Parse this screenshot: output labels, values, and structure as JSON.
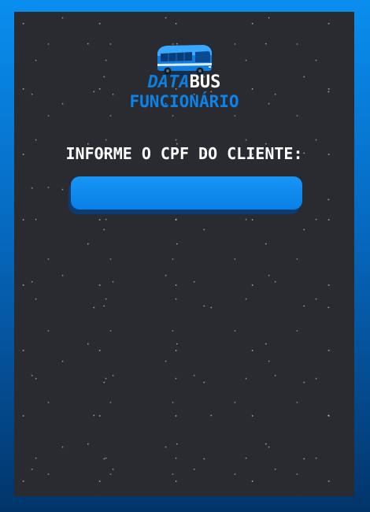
{
  "brand": {
    "part1": "DATA",
    "part2": "BUS",
    "subtitle": "FUNCIONÁRIO",
    "icon": "bus-icon"
  },
  "form": {
    "prompt": "INFORME O CPF DO CLIENTE:",
    "cpf_value": "",
    "cpf_placeholder": ""
  },
  "colors": {
    "accent": "#0a84ea",
    "panel": "#2a2b30",
    "frame_top": "#0a8eef",
    "frame_bottom": "#02346a",
    "input_shadow": "#0b3c73"
  }
}
